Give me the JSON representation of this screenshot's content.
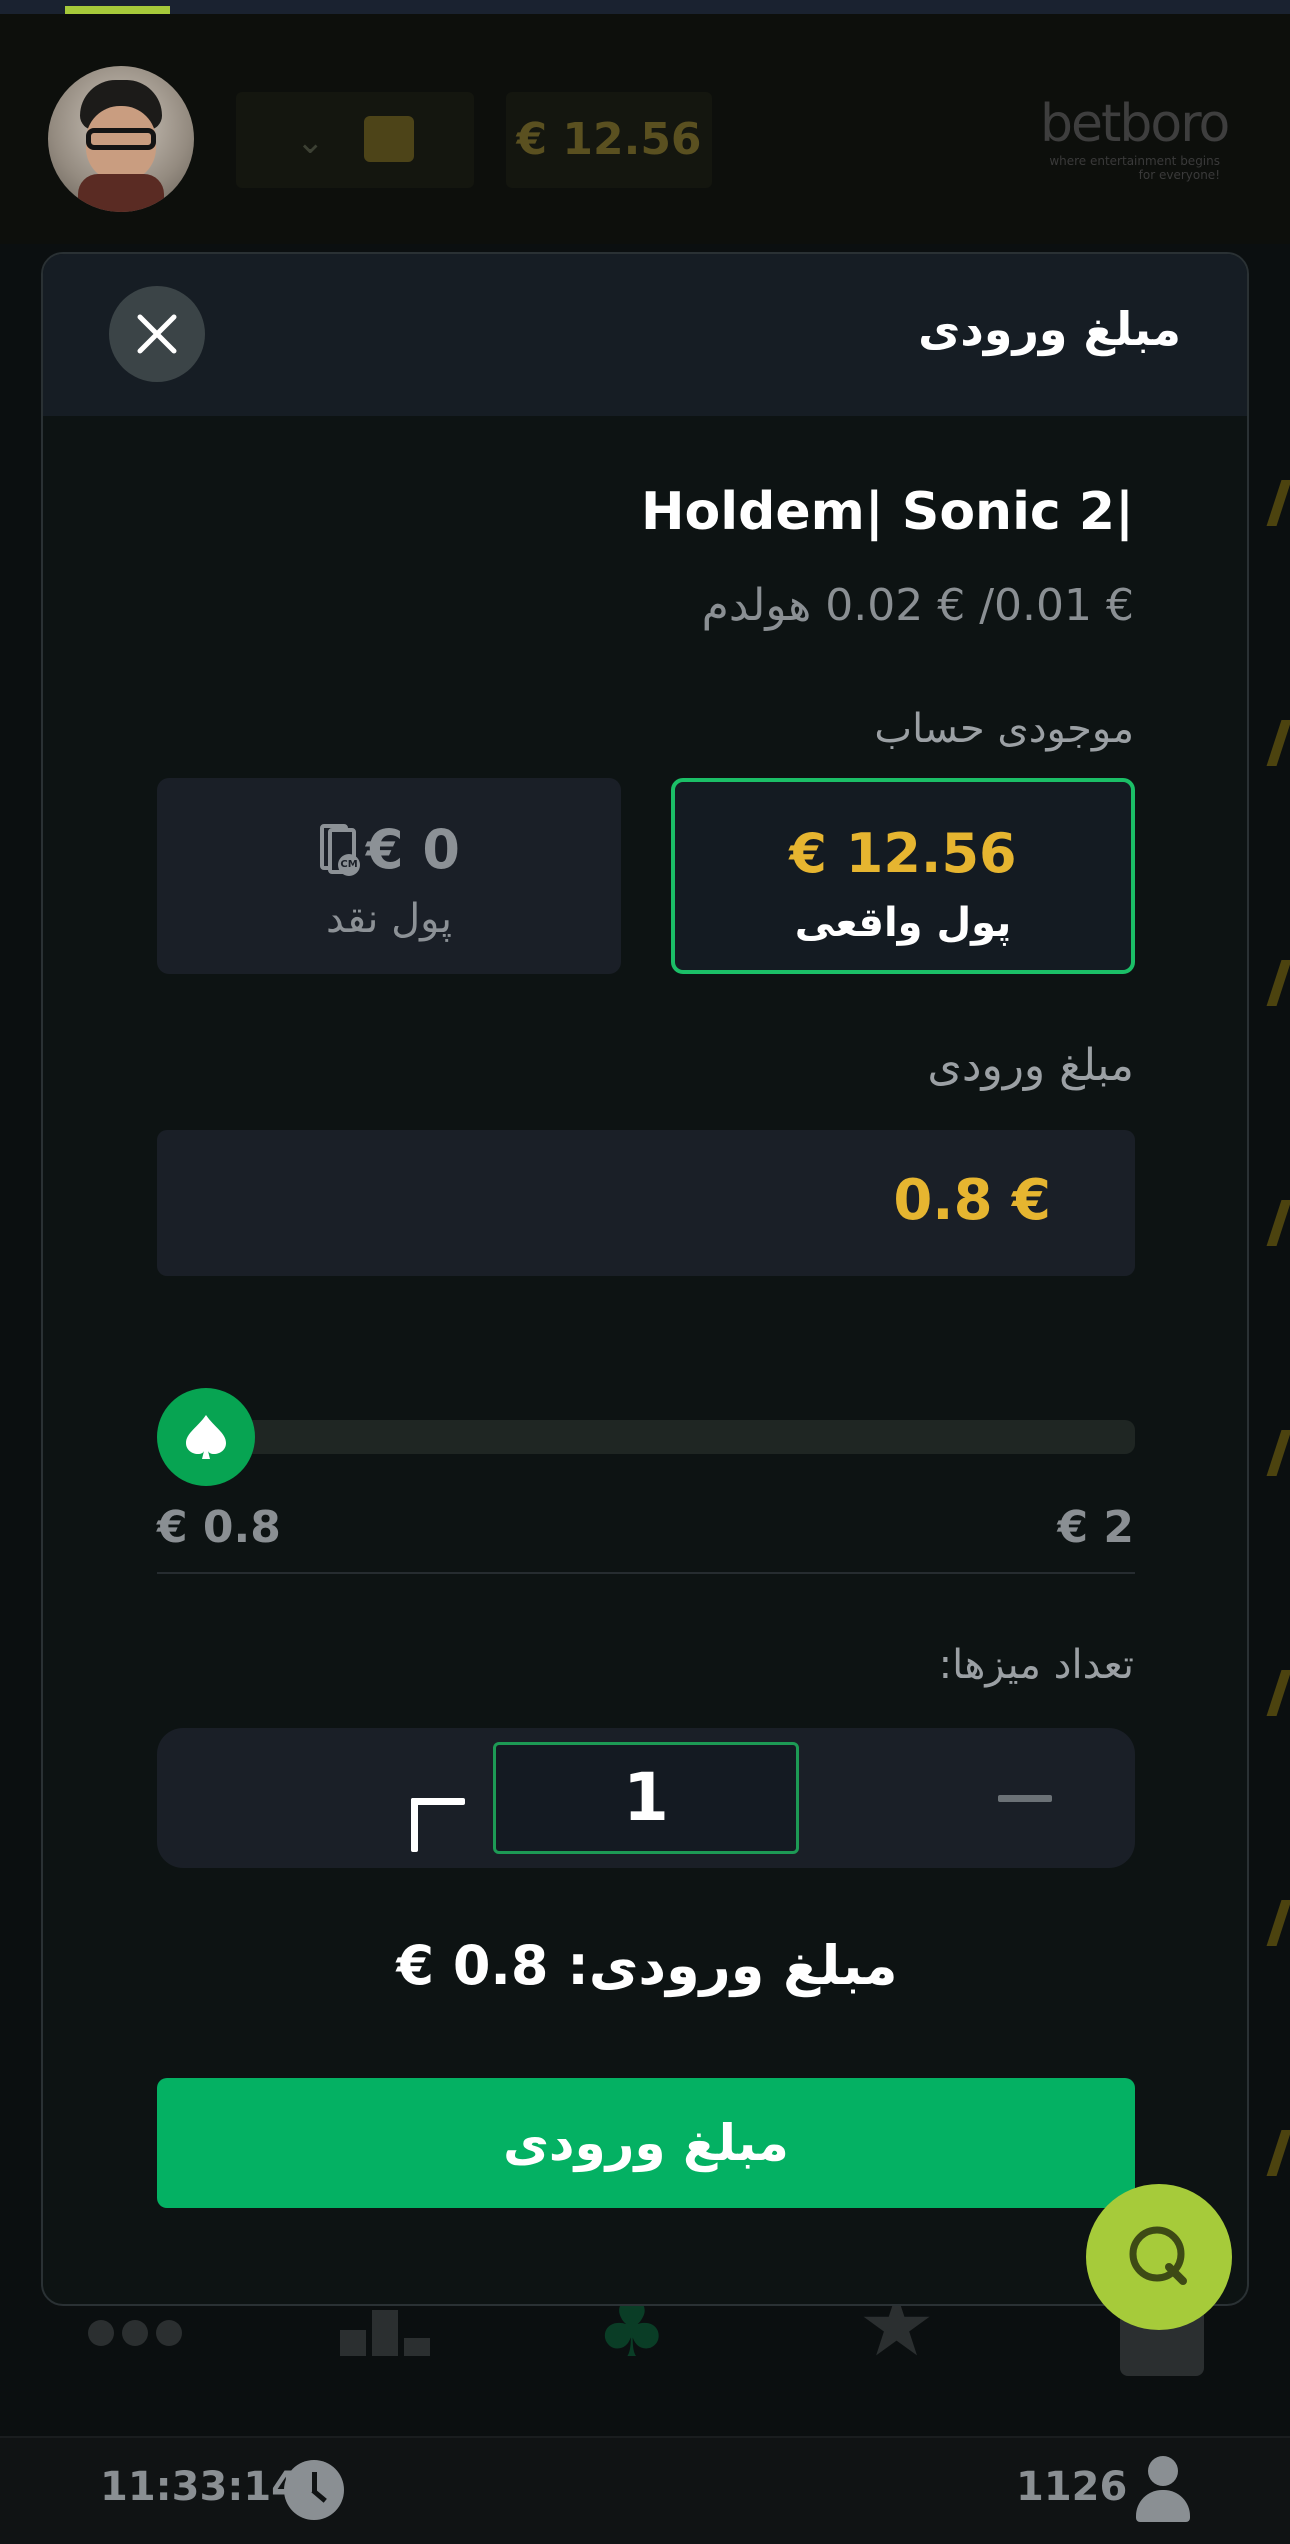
{
  "header": {
    "balance": "€ 12.56",
    "logo_text": "betboro",
    "logo_tagline": "where entertainment begins for everyone!",
    "progress_fraction": 0.08
  },
  "modal": {
    "title": "مبلغ ورودی",
    "game_name": "Holdem| Sonic 2|",
    "game_stakes": "€ 0.01/ € 0.02 هولدم",
    "account_balance_label": "موجودی حساب",
    "real_money": {
      "amount": "€ 12.56",
      "label": "پول واقعی",
      "selected": true
    },
    "cash_money": {
      "amount": "€ 0",
      "label": "پول نقد",
      "selected": false
    },
    "buyin_label": "مبلغ ورودی",
    "buyin_value": "0.8 €",
    "slider": {
      "min_label": "€ 0.8",
      "max_label": "€ 2",
      "value": 0.8,
      "min": 0.8,
      "max": 2
    },
    "tables_label": "تعداد میزها:",
    "tables_count": "1",
    "summary": "مبلغ ورودی: 0.8 €",
    "submit_label": "مبلغ ورودی"
  },
  "footer": {
    "time": "11:33:14",
    "players_online": "1126"
  },
  "colors": {
    "accent_green": "#04b163",
    "gold": "#e6b530",
    "chat_fab": "#a6cb3a"
  },
  "icons": [
    "close-icon",
    "cash-icon",
    "spade-icon",
    "plus-icon",
    "minus-icon",
    "chat-icon",
    "clock-icon",
    "user-icon",
    "wallet-icon",
    "chevron-down-icon"
  ]
}
